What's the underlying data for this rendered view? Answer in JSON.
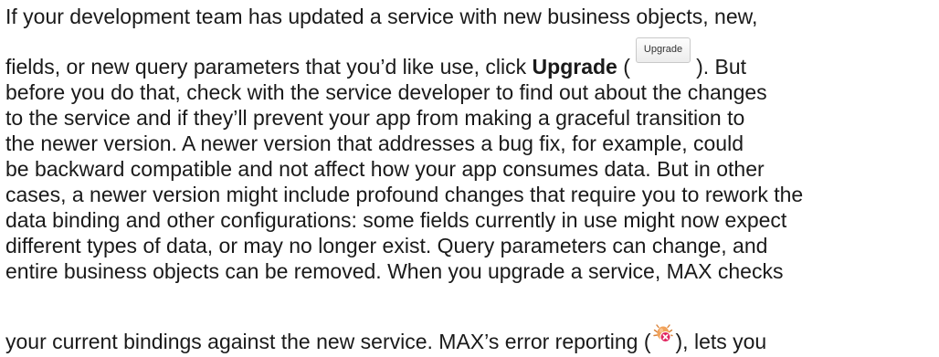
{
  "paragraph": {
    "line1": "If your development team has updated a service with new business objects, new,",
    "line2_pre": "fields, or new query parameters that you’d like use, click ",
    "line2_bold": "Upgrade",
    "line2_open": " (",
    "upgrade_button_label": "Upgrade",
    "line2_post": "). But",
    "line3": "before you do that, check with the service developer to find out about the changes",
    "line4": "to the service and if they’ll prevent your app from making a graceful transition to",
    "line5": "the newer version. A newer version that addresses a bug fix, for example, could",
    "line6": "be backward compatible and not affect how your app consumes data. But in other",
    "line7": "cases, a newer version might include profound changes that require you to rework the",
    "line8": "data binding and other configurations: some fields currently in use might now expect",
    "line9": "different types of data, or may no longer exist. Query parameters can change, and",
    "line10": "entire business objects can be removed. When you upgrade a service, MAX checks",
    "line12_pre": "your current bindings against the new service. MAX’s error reporting (",
    "line12_post": "), lets you"
  },
  "icons": {
    "error_reporting_icon": "bug-error-icon"
  },
  "colors": {
    "text": "#1a1a1a",
    "bug_body": "#f2a25a",
    "error_badge": "#e0245e"
  }
}
